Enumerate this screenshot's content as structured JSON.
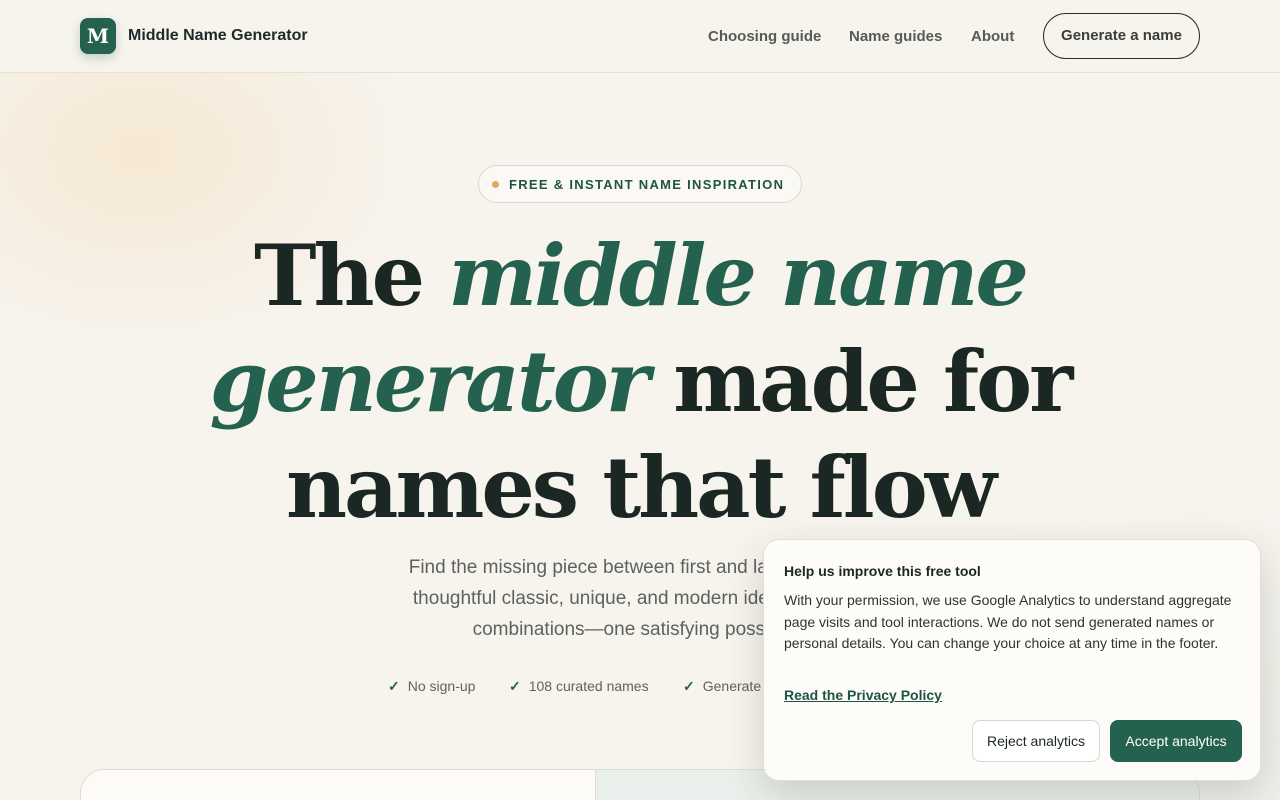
{
  "header": {
    "logo_letter": "M",
    "brand": "Middle Name Generator",
    "nav": [
      "Choosing guide",
      "Name guides",
      "About"
    ],
    "cta": "Generate a name"
  },
  "hero": {
    "pill": "FREE & INSTANT NAME INSPIRATION",
    "headline": {
      "part1": "The ",
      "em1": "middle name",
      "em2": "generator",
      "part2": " made for",
      "line3": "names that flow"
    },
    "sub": [
      "Find the missing piece between first and last. Our midd",
      "thoughtful classic, unique, and modern ideas for boys,",
      "combinations—one satisfying possibility"
    ],
    "checks": [
      "No sign-up",
      "108 curated names",
      "Generate"
    ]
  },
  "consent": {
    "title": "Help us improve this free tool",
    "body": "With your permission, we use Google Analytics to understand aggregate page visits and tool interactions. We do not send generated names or personal details. You can change your choice at any time in the footer.",
    "link": "Read the Privacy Policy",
    "reject": "Reject analytics",
    "accept": "Accept analytics"
  },
  "colors": {
    "accent": "#24614f",
    "background": "#f7f4ee",
    "dot": "#e6a85a"
  }
}
